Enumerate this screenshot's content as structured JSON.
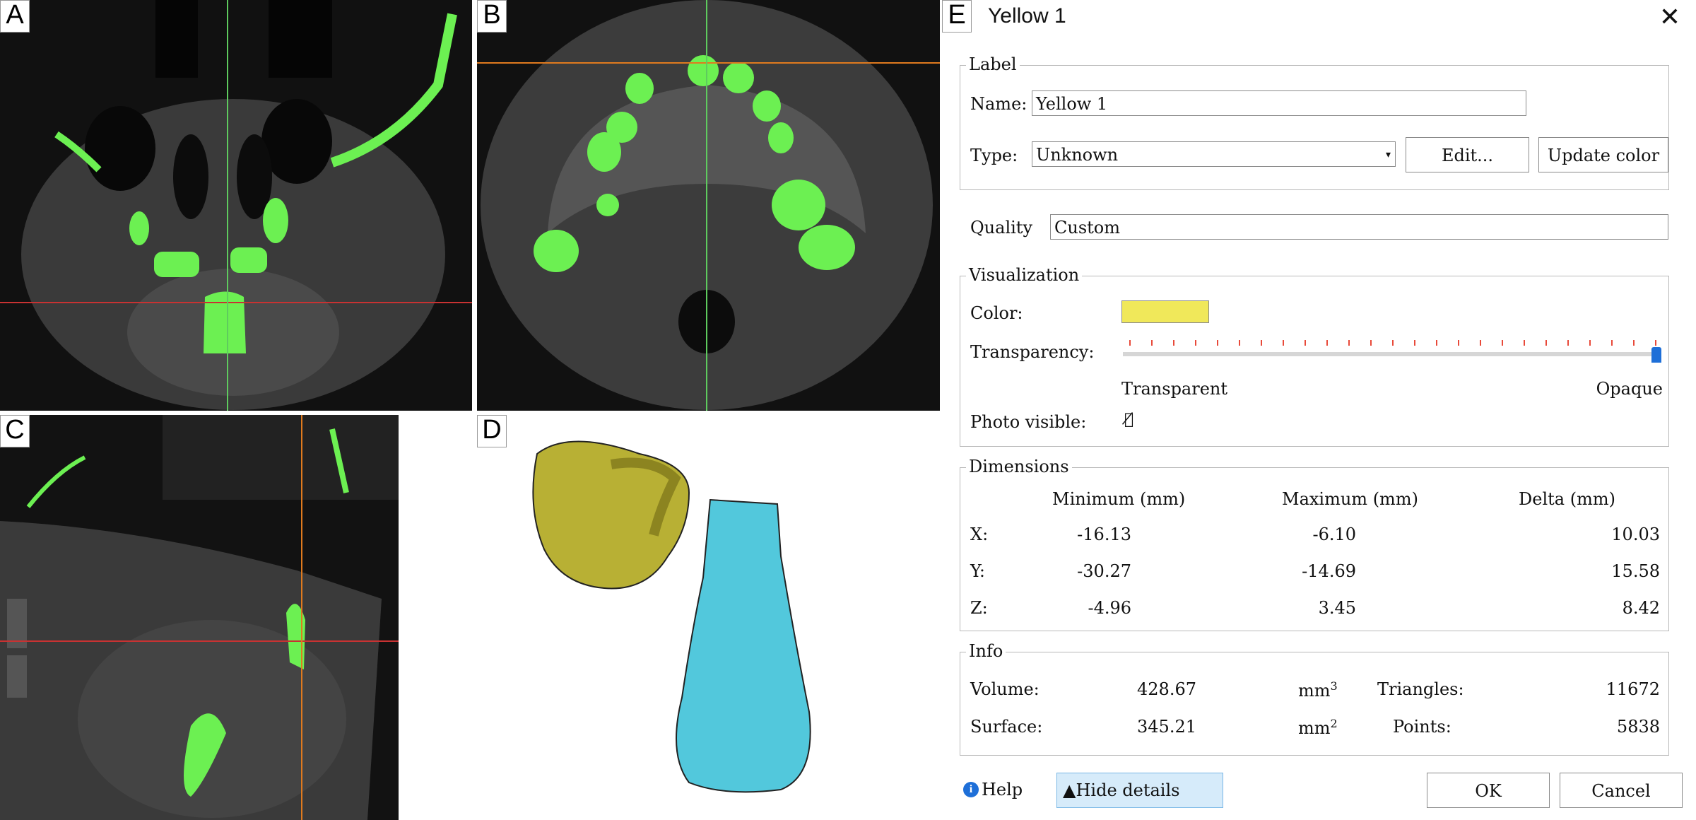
{
  "panels": {
    "a": {
      "label": "A"
    },
    "b": {
      "label": "B"
    },
    "c": {
      "label": "C"
    },
    "d": {
      "label": "D"
    },
    "e": {
      "label": "E"
    }
  },
  "dialog": {
    "title": "Yellow 1",
    "label_group": {
      "title": "Label",
      "name_label": "Name:",
      "name_value": "Yellow 1",
      "type_label": "Type:",
      "type_value": "Unknown",
      "edit_button": "Edit...",
      "update_color_button": "Update color"
    },
    "quality": {
      "label": "Quality",
      "value": "Custom"
    },
    "visualization": {
      "title": "Visualization",
      "color_label": "Color:",
      "color_value": "#f0e85a",
      "transparency_label": "Transparency:",
      "transparency_level": 1.0,
      "min_label": "Transparent",
      "max_label": "Opaque",
      "photo_visible_label": "Photo visible:"
    },
    "dimensions": {
      "title": "Dimensions",
      "headers": [
        "Minimum (mm)",
        "Maximum (mm)",
        "Delta (mm)"
      ],
      "rows": [
        {
          "axis": "X:",
          "min": "-16.13",
          "max": "-6.10",
          "delta": "10.03"
        },
        {
          "axis": "Y:",
          "min": "-30.27",
          "max": "-14.69",
          "delta": "15.58"
        },
        {
          "axis": "Z:",
          "min": "-4.96",
          "max": "3.45",
          "delta": "8.42"
        }
      ]
    },
    "info": {
      "title": "Info",
      "volume_label": "Volume:",
      "volume_value": "428.67",
      "volume_unit": "mm",
      "volume_exp": "3",
      "surface_label": "Surface:",
      "surface_value": "345.21",
      "surface_unit": "mm",
      "surface_exp": "2",
      "triangles_label": "Triangles:",
      "triangles_value": "11672",
      "points_label": "Points:",
      "points_value": "5838"
    },
    "footer": {
      "help": "Help",
      "hide_details": "Hide details",
      "ok": "OK",
      "cancel": "Cancel"
    }
  },
  "colors": {
    "segmentation": "#6cf052",
    "crosshair_green": "#5ecb5e",
    "crosshair_red": "#c83232",
    "crosshair_orange": "#e07a1e",
    "tooth_yellow": "#b8b034",
    "tooth_cyan": "#52c8dc",
    "accent_blue": "#1e6fd8"
  }
}
